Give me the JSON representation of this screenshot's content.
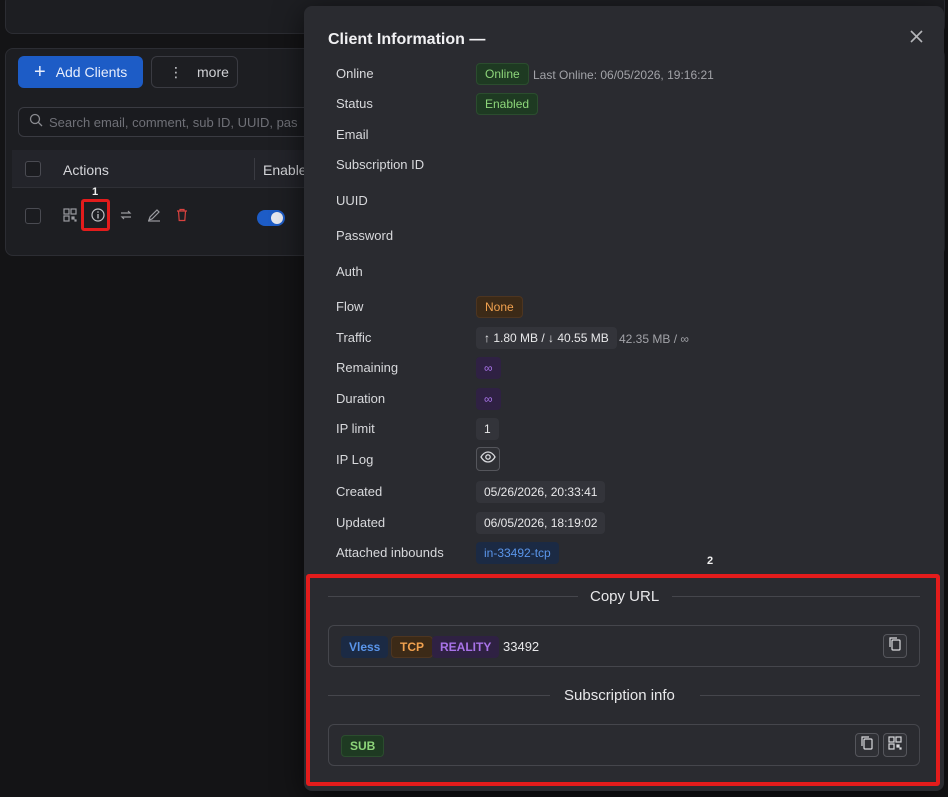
{
  "background": {
    "add_clients_label": "Add Clients",
    "more_label": "more",
    "search_placeholder": "Search email, comment, sub ID, UUID, pas",
    "col_actions": "Actions",
    "col_enabled": "Enabled"
  },
  "annotations": {
    "marker1": "1",
    "marker2": "2"
  },
  "modal": {
    "title": "Client Information —",
    "rows": {
      "online": {
        "label": "Online",
        "tag": "Online",
        "extra": "Last Online: 06/05/2026, 19:16:21"
      },
      "status": {
        "label": "Status",
        "tag": "Enabled"
      },
      "email": {
        "label": "Email"
      },
      "subscription_id": {
        "label": "Subscription ID"
      },
      "uuid": {
        "label": "UUID"
      },
      "password": {
        "label": "Password"
      },
      "auth": {
        "label": "Auth"
      },
      "flow": {
        "label": "Flow",
        "tag": "None"
      },
      "traffic": {
        "label": "Traffic",
        "tag": "↑ 1.80 MB / ↓ 40.55 MB",
        "extra": "42.35 MB / ∞"
      },
      "remaining": {
        "label": "Remaining",
        "tag": "∞"
      },
      "duration": {
        "label": "Duration",
        "tag": "∞"
      },
      "ip_limit": {
        "label": "IP limit",
        "tag": "1"
      },
      "ip_log": {
        "label": "IP Log"
      },
      "created": {
        "label": "Created",
        "tag": "05/26/2026, 20:33:41"
      },
      "updated": {
        "label": "Updated",
        "tag": "06/05/2026, 18:19:02"
      },
      "attached_inbounds": {
        "label": "Attached inbounds",
        "tag": "in-33492-tcp"
      }
    },
    "copy_url": {
      "heading": "Copy URL",
      "tags": [
        "Vless",
        "TCP",
        "REALITY"
      ],
      "port": "33492"
    },
    "subscription": {
      "heading": "Subscription info",
      "tag": "SUB"
    }
  },
  "colors": {
    "accent_blue": "#1d5cc6",
    "highlight_red": "#e31c1c",
    "tag_green": "#8dd67a",
    "tag_orange": "#f1a14f",
    "tag_purple": "#a873e8"
  }
}
